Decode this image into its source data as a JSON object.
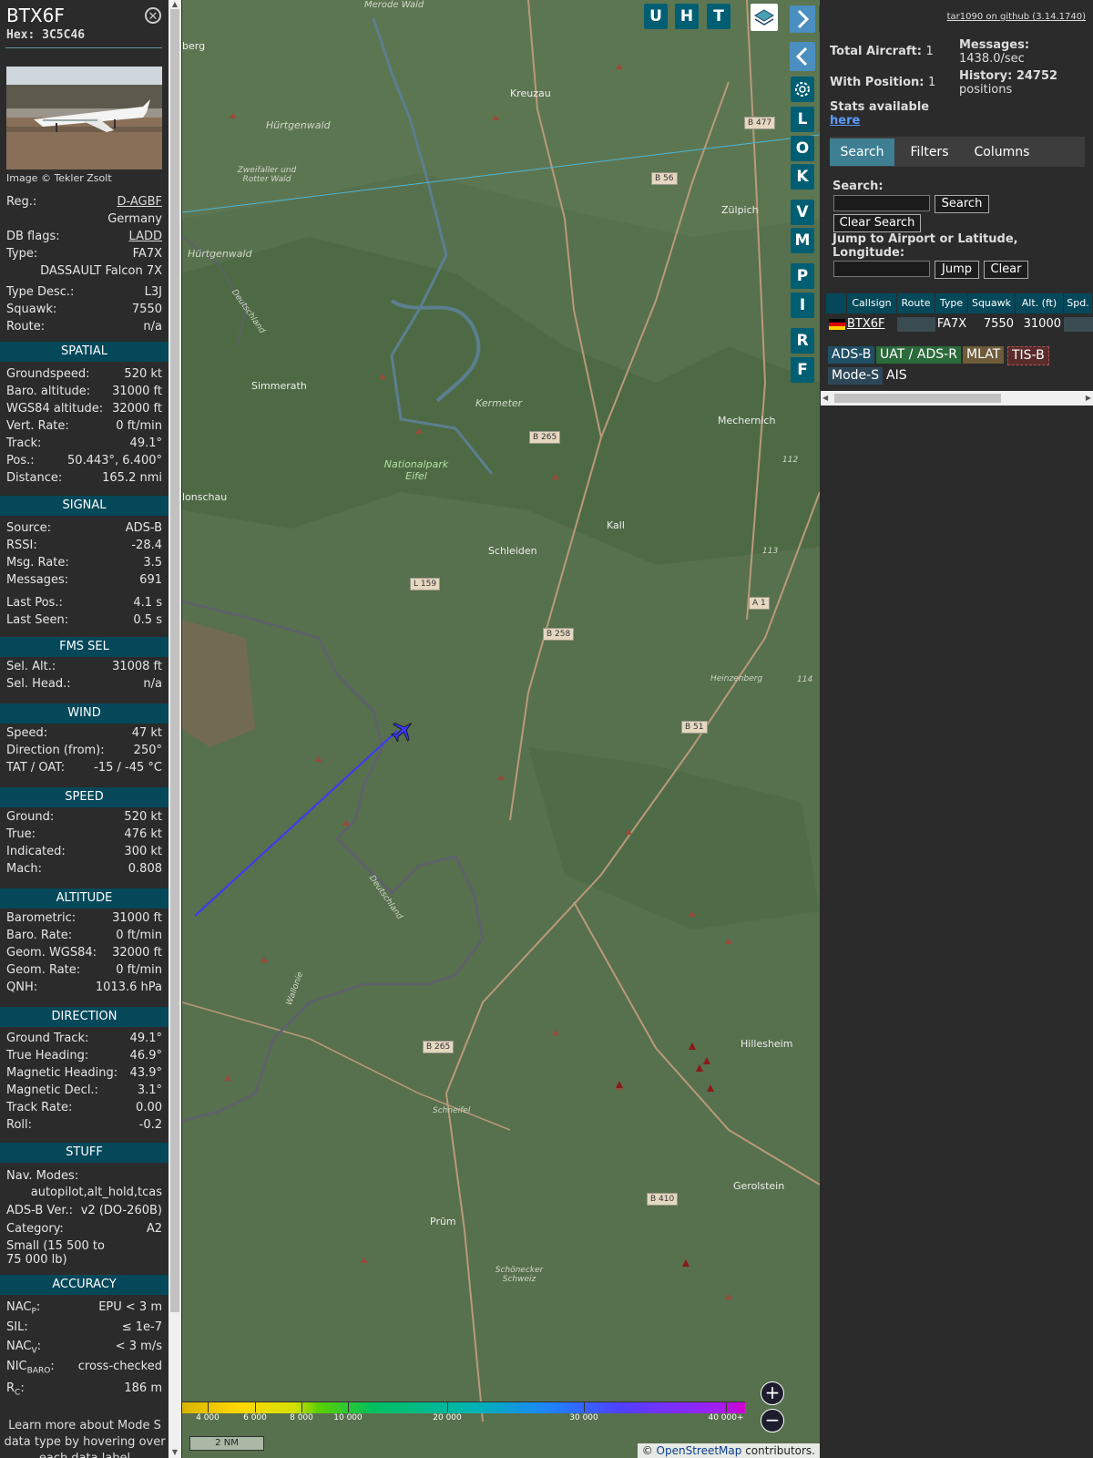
{
  "aircraft": {
    "callsign": "BTX6F",
    "hex_label": "Hex: 3C5C46",
    "photo_credit": "Image © Tekler Zsolt",
    "reg_label": "Reg.:",
    "reg": "D-AGBF",
    "country": "Germany",
    "db_flags_label": "DB flags:",
    "db_flags": "LADD",
    "type_label": "Type:",
    "type": "FA7X",
    "type_name": "DASSAULT Falcon 7X",
    "type_desc_label": "Type Desc.:",
    "type_desc": "L3J",
    "squawk_label": "Squawk:",
    "squawk": "7550",
    "route_label": "Route:",
    "route": "n/a"
  },
  "sections": {
    "spatial": {
      "title": "SPATIAL",
      "rows": [
        {
          "label": "Groundspeed:",
          "value": "520 kt"
        },
        {
          "label": "Baro. altitude:",
          "value": "31000 ft"
        },
        {
          "label": "WGS84 altitude:",
          "value": "32000 ft"
        },
        {
          "label": "Vert. Rate:",
          "value": "0 ft/min"
        },
        {
          "label": "Track:",
          "value": "49.1°"
        },
        {
          "label": "Pos.:",
          "value": "50.443°, 6.400°"
        },
        {
          "label": "Distance:",
          "value": "165.2 nmi"
        }
      ]
    },
    "signal": {
      "title": "SIGNAL",
      "rows": [
        {
          "label": "Source:",
          "value": "ADS-B"
        },
        {
          "label": "RSSI:",
          "value": "-28.4"
        },
        {
          "label": "Msg. Rate:",
          "value": "3.5"
        },
        {
          "label": "Messages:",
          "value": "691"
        },
        {
          "label": "Last Pos.:",
          "value": "4.1 s"
        },
        {
          "label": "Last Seen:",
          "value": "0.5 s"
        }
      ]
    },
    "fms": {
      "title": "FMS SEL",
      "rows": [
        {
          "label": "Sel. Alt.:",
          "value": "31008 ft"
        },
        {
          "label": "Sel. Head.:",
          "value": "n/a"
        }
      ]
    },
    "wind": {
      "title": "WIND",
      "rows": [
        {
          "label": "Speed:",
          "value": "47 kt"
        },
        {
          "label": "Direction (from):",
          "value": "250°"
        },
        {
          "label": "TAT / OAT:",
          "value": "-15 / -45 °C"
        }
      ]
    },
    "speed": {
      "title": "SPEED",
      "rows": [
        {
          "label": "Ground:",
          "value": "520 kt"
        },
        {
          "label": "True:",
          "value": "476 kt"
        },
        {
          "label": "Indicated:",
          "value": "300 kt"
        },
        {
          "label": "Mach:",
          "value": "0.808"
        }
      ]
    },
    "altitude": {
      "title": "ALTITUDE",
      "rows": [
        {
          "label": "Barometric:",
          "value": "31000 ft"
        },
        {
          "label": "Baro. Rate:",
          "value": "0 ft/min"
        },
        {
          "label": "Geom. WGS84:",
          "value": "32000 ft"
        },
        {
          "label": "Geom. Rate:",
          "value": "0 ft/min"
        },
        {
          "label": "QNH:",
          "value": "1013.6 hPa"
        }
      ]
    },
    "direction": {
      "title": "DIRECTION",
      "rows": [
        {
          "label": "Ground Track:",
          "value": "49.1°"
        },
        {
          "label": "True Heading:",
          "value": "46.9°"
        },
        {
          "label": "Magnetic Heading:",
          "value": "43.9°"
        },
        {
          "label": "Magnetic Decl.:",
          "value": "3.1°"
        },
        {
          "label": "Track Rate:",
          "value": "0.00"
        },
        {
          "label": "Roll:",
          "value": "-0.2"
        }
      ]
    },
    "stuff": {
      "title": "STUFF",
      "nav_label": "Nav. Modes:",
      "nav_value": "autopilot,alt_hold,tcas",
      "adsb_label": "ADS-B Ver.:",
      "adsb_value": "v2 (DO-260B)",
      "cat_label": "Category:",
      "cat_value": "A2",
      "cat_desc_1": "Small (15 500 to",
      "cat_desc_2": "75 000 lb)"
    },
    "accuracy": {
      "title": "ACCURACY",
      "nacp_label": "NAC",
      "nacp_sub": "P",
      "nacp_value": "EPU < 3 m",
      "sil_label": "SIL:",
      "sil_value": "≤ 1e-7",
      "nacv_label": "NAC",
      "nacv_sub": "V",
      "nacv_value": "< 3 m/s",
      "nic_label": "NIC",
      "nic_sub": "BARO",
      "nic_value": "cross-checked",
      "rc_label": "R",
      "rc_sub": "C",
      "rc_value": "186 m"
    },
    "learn_more_1": "Learn more about Mode S",
    "learn_more_2": "data type by hovering over",
    "learn_more_3": "each data label"
  },
  "map": {
    "top_buttons": [
      "U",
      "H",
      "T"
    ],
    "side_buttons": [
      "L",
      "O",
      "K",
      "V",
      "M",
      "P",
      "I",
      "R",
      "F"
    ],
    "places": [
      {
        "name": "Kreuzau"
      },
      {
        "name": "Hürtgenwald"
      },
      {
        "name": "Zweifaller und Rotter Wald"
      },
      {
        "name": "Zülpich"
      },
      {
        "name": "Simmerath"
      },
      {
        "name": "Kermeter"
      },
      {
        "name": "Mechernich"
      },
      {
        "name": "Nationalpark Eifel"
      },
      {
        "name": "Schleiden"
      },
      {
        "name": "Kall"
      },
      {
        "name": "Heinzenberg"
      },
      {
        "name": "Hillesheim"
      },
      {
        "name": "Schneifel"
      },
      {
        "name": "Gerolstein"
      },
      {
        "name": "Prüm"
      },
      {
        "name": "Schönecker Schweiz"
      },
      {
        "name": "Deutschland"
      },
      {
        "name": "Wallonie"
      },
      {
        "name": "Merode Wald"
      },
      {
        "name": "lonschau"
      },
      {
        "name": "berg"
      }
    ],
    "road_labels": [
      "B 477",
      "B 56",
      "B 265",
      "L 159",
      "B 258",
      "A 1",
      "B 51",
      "B 265",
      "B 410",
      "112",
      "113",
      "114"
    ],
    "altitude_scale": [
      "4 000",
      "6 000",
      "8 000",
      "10 000",
      "20 000",
      "30 000",
      "40 000+"
    ],
    "scale_label": "2 NM",
    "attribution_prefix": "© ",
    "attribution_link": "OpenStreetMap",
    "attribution_suffix": " contributors.",
    "zoom_in": "+",
    "zoom_out": "−"
  },
  "right": {
    "github_link": "tar1090 on github (3.14.1740)",
    "total_aircraft_label": "Total Aircraft:",
    "total_aircraft": "1",
    "with_position_label": "With Position:",
    "with_position": "1",
    "messages_label": "Messages:",
    "messages_rate": "1438.0/sec",
    "history_label": "History: 24752",
    "history_unit": "positions",
    "stats_label": "Stats available",
    "stats_link": "here",
    "tabs": [
      "Search",
      "Filters",
      "Columns"
    ],
    "search_label": "Search:",
    "search_button": "Search",
    "clear_search_button": "Clear Search",
    "jump_label_1": "Jump to Airport or Latitude,",
    "jump_label_2": "Longitude:",
    "jump_button": "Jump",
    "clear_button": "Clear",
    "columns": [
      "Callsign",
      "Route",
      "Type",
      "Squawk",
      "Alt. (ft)",
      "Spd."
    ],
    "row": {
      "callsign": "BTX6F",
      "route": "",
      "type": "FA7X",
      "squawk": "7550",
      "alt": "31000"
    },
    "legend": [
      "ADS-B",
      "UAT / ADS-R",
      "MLAT",
      "TIS-B",
      "Mode-S",
      "AIS"
    ]
  },
  "colors": {
    "section_bg": "#04485a",
    "accent_button": "#005e73",
    "adsb": "#1f4f66",
    "uat": "#2b6a3a",
    "mlat": "#6d5b3a",
    "tisb": "#5a2b2b",
    "modes": "#2e4758",
    "track": "#3b38ff"
  }
}
